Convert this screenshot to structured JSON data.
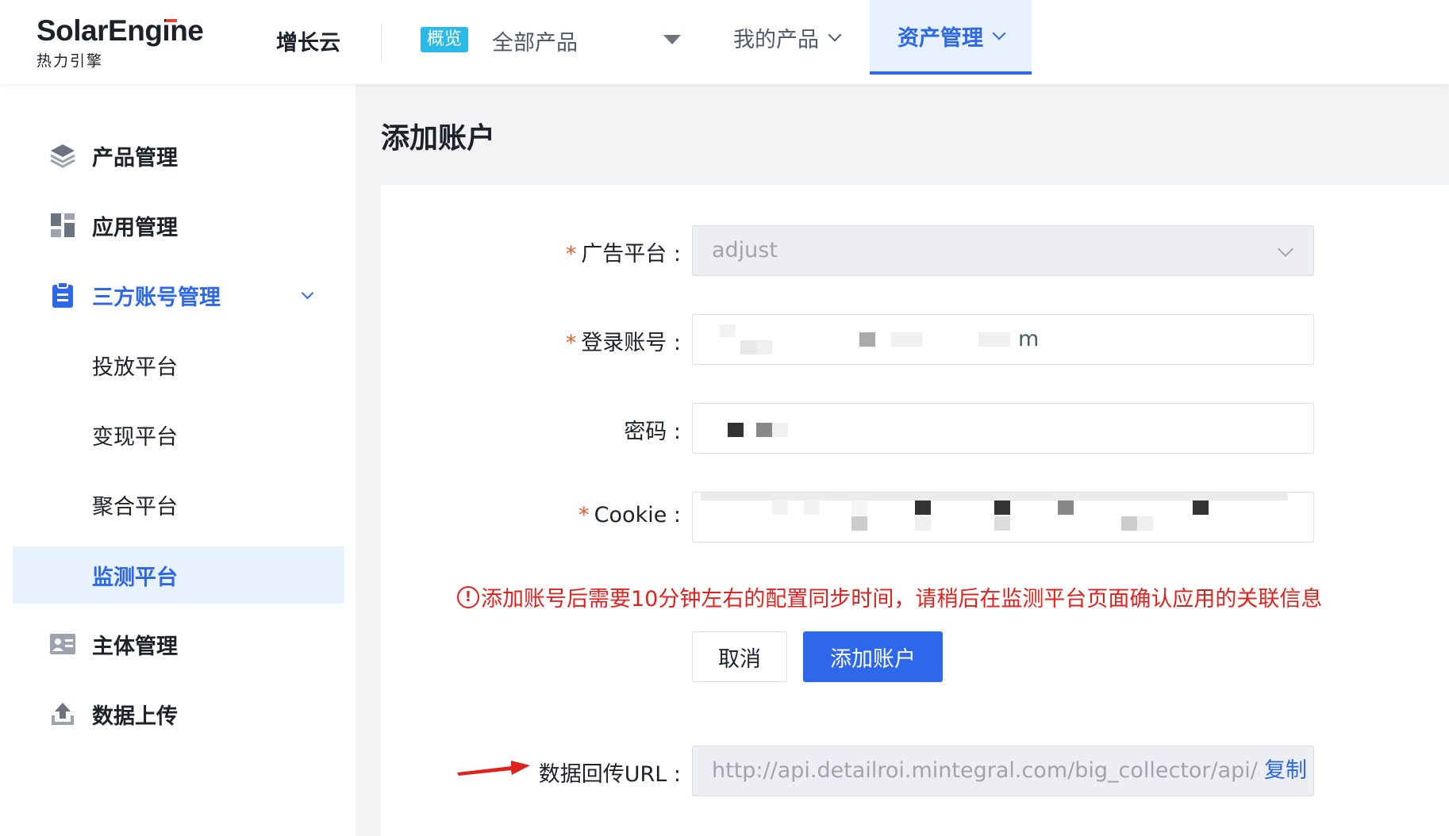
{
  "header": {
    "logo_main": "SolarEngine",
    "logo_sub": "热力引擎",
    "product_line": "增长云",
    "overview_badge": "概览",
    "product_selector": "全部产品",
    "nav": [
      {
        "label": "我的产品",
        "active": false
      },
      {
        "label": "资产管理",
        "active": true
      }
    ]
  },
  "sidebar": {
    "items": [
      {
        "label": "产品管理",
        "icon": "layers-icon"
      },
      {
        "label": "应用管理",
        "icon": "dashboard-icon"
      },
      {
        "label": "三方账号管理",
        "icon": "clipboard-icon",
        "expanded": true,
        "children": [
          {
            "label": "投放平台",
            "active": false
          },
          {
            "label": "变现平台",
            "active": false
          },
          {
            "label": "聚合平台",
            "active": false
          },
          {
            "label": "监测平台",
            "active": true
          }
        ]
      },
      {
        "label": "主体管理",
        "icon": "id-card-icon"
      },
      {
        "label": "数据上传",
        "icon": "upload-icon"
      }
    ]
  },
  "page": {
    "title": "添加账户"
  },
  "form": {
    "ad_platform": {
      "label": "广告平台 :",
      "required": true,
      "value": "adjust"
    },
    "login_account": {
      "label": "登录账号 :",
      "required": true,
      "visible_suffix": "m"
    },
    "password": {
      "label": "密码 :",
      "required": false
    },
    "cookie": {
      "label": "Cookie :",
      "required": true
    },
    "required_mark": "*"
  },
  "notice": {
    "icon": "!",
    "text": "添加账号后需要10分钟左右的配置同步时间，请稍后在监测平台页面确认应用的关联信息"
  },
  "buttons": {
    "cancel": "取消",
    "add": "添加账户"
  },
  "callback": {
    "label": "数据回传URL :",
    "url": "http://api.detailroi.mintegral.com/big_collector/api/adjust",
    "copy": "复制"
  },
  "colors": {
    "primary": "#2d68ea",
    "error": "#e0221f",
    "required": "#f05a28",
    "badge": "#2bb9e6"
  }
}
